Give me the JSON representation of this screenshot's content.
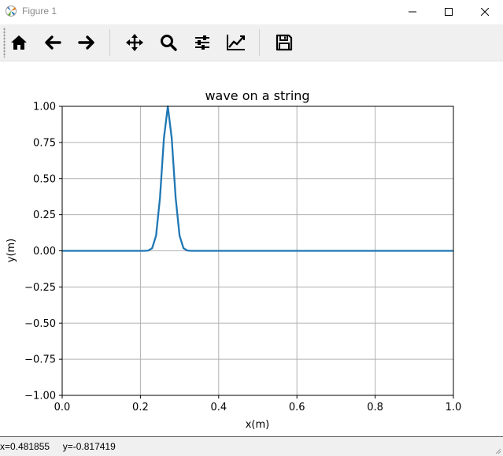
{
  "window": {
    "title": "Figure 1"
  },
  "toolbar": {
    "buttons": [
      {
        "name": "home",
        "icon": "home-icon"
      },
      {
        "name": "back",
        "icon": "arrow-left-icon"
      },
      {
        "name": "forward",
        "icon": "arrow-right-icon"
      },
      {
        "name": "pan",
        "icon": "move-icon"
      },
      {
        "name": "zoom",
        "icon": "magnifier-icon"
      },
      {
        "name": "subplots",
        "icon": "sliders-icon"
      },
      {
        "name": "customize",
        "icon": "line-chart-icon"
      },
      {
        "name": "save",
        "icon": "floppy-disk-icon"
      }
    ]
  },
  "status": {
    "text": "x=0.481855     y=-0.817419"
  },
  "colors": {
    "line": "#1f77b4",
    "grid": "#b0b0b0",
    "toolbar_bg": "#f0f0f0"
  },
  "chart_data": {
    "type": "line",
    "title": "wave on a string",
    "xlabel": "x(m)",
    "ylabel": "y(m)",
    "xlim": [
      0.0,
      1.0
    ],
    "ylim": [
      -1.0,
      1.0
    ],
    "xticks": [
      "0.0",
      "0.2",
      "0.4",
      "0.6",
      "0.8",
      "1.0"
    ],
    "yticks": [
      "1.00",
      "0.75",
      "0.50",
      "0.25",
      "0.00",
      "−0.25",
      "−0.50",
      "−0.75",
      "−1.00"
    ],
    "ytick_values": [
      1.0,
      0.75,
      0.5,
      0.25,
      0.0,
      -0.25,
      -0.5,
      -0.75,
      -1.0
    ],
    "xtick_values": [
      0.0,
      0.2,
      0.4,
      0.6,
      0.8,
      1.0
    ],
    "grid": true,
    "series": [
      {
        "x": [
          0.0,
          0.01,
          0.02,
          0.03,
          0.04,
          0.05,
          0.06,
          0.07,
          0.08,
          0.09,
          0.1,
          0.11,
          0.12,
          0.13,
          0.14,
          0.15,
          0.16,
          0.17,
          0.18,
          0.19,
          0.2,
          0.21,
          0.22,
          0.23,
          0.24,
          0.25,
          0.26,
          0.27,
          0.28,
          0.29,
          0.3,
          0.31,
          0.32,
          0.33,
          0.34,
          0.35,
          0.36,
          0.37,
          0.38,
          0.39,
          0.4,
          0.41,
          0.42,
          0.43,
          0.44,
          0.45,
          0.46,
          0.47,
          0.48,
          0.49,
          0.5,
          0.51,
          0.52,
          0.53,
          0.54,
          0.55,
          0.56,
          0.57,
          0.58,
          0.59,
          0.6,
          0.61,
          0.62,
          0.63,
          0.64,
          0.65,
          0.66,
          0.67,
          0.68,
          0.69,
          0.7,
          0.71,
          0.72,
          0.73,
          0.74,
          0.75,
          0.76,
          0.77,
          0.78,
          0.79,
          0.8,
          0.81,
          0.82,
          0.83,
          0.84,
          0.85,
          0.86,
          0.87,
          0.88,
          0.89,
          0.9,
          0.91,
          0.92,
          0.93,
          0.94,
          0.95,
          0.96,
          0.97,
          0.98,
          0.99,
          1.0
        ],
        "y": [
          0,
          0,
          0,
          0,
          0,
          0,
          0,
          0,
          0,
          0,
          0,
          0,
          0,
          0,
          0,
          0,
          0,
          0,
          0,
          0,
          0,
          0.0001,
          0.0019,
          0.0183,
          0.1054,
          0.3679,
          0.7788,
          1.0,
          0.7788,
          0.3679,
          0.1054,
          0.0183,
          0.0019,
          0.0001,
          0,
          0,
          0,
          0,
          0,
          0,
          0,
          0,
          0,
          0,
          0,
          0,
          0,
          0,
          0,
          0,
          0,
          0,
          0,
          0,
          0,
          0,
          0,
          0,
          0,
          0,
          0,
          0,
          0,
          0,
          0,
          0,
          0,
          0,
          0,
          0,
          0,
          0,
          0,
          0,
          0,
          0,
          0,
          0,
          0,
          0,
          0,
          0,
          0,
          0,
          0,
          0,
          0,
          0,
          0,
          0,
          0,
          0,
          0,
          0,
          0,
          0,
          0,
          0,
          0,
          0,
          0
        ]
      }
    ]
  }
}
